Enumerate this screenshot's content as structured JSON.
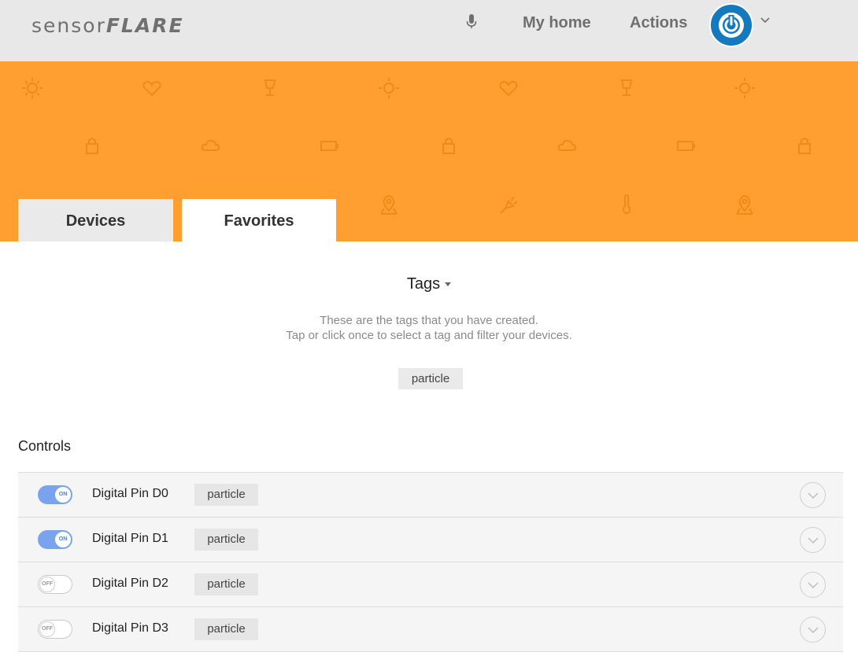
{
  "header": {
    "logo_light": "sensor",
    "logo_bold": "FLARE",
    "nav": {
      "home_label": "My home",
      "actions_label": "Actions"
    },
    "icons": [
      "microphone-icon",
      "power-icon",
      "chevron-down-icon"
    ]
  },
  "banner": {
    "color": "#ff9f31",
    "pattern_icons": [
      "sun-icon",
      "heart-icon",
      "lamp-icon",
      "lock-icon",
      "cloud-icon",
      "battery-icon",
      "location-icon",
      "plug-icon",
      "thermometer-icon"
    ]
  },
  "tabs": {
    "devices": "Devices",
    "favorites": "Favorites",
    "active": "Favorites"
  },
  "tags": {
    "title": "Tags",
    "desc_line1": "These are the tags that you have created.",
    "desc_line2": "Tap or click once to select a tag and filter your devices.",
    "items": [
      "particle"
    ]
  },
  "controls": {
    "title": "Controls",
    "rows": [
      {
        "label": "Digital Pin D0",
        "tag": "particle",
        "state": "ON"
      },
      {
        "label": "Digital Pin D1",
        "tag": "particle",
        "state": "ON"
      },
      {
        "label": "Digital Pin D2",
        "tag": "particle",
        "state": "OFF"
      },
      {
        "label": "Digital Pin D3",
        "tag": "particle",
        "state": "OFF"
      }
    ]
  },
  "colors": {
    "accent": "#1479bd",
    "toggle_on": "#7aa3ee",
    "banner": "#ff9f31"
  }
}
